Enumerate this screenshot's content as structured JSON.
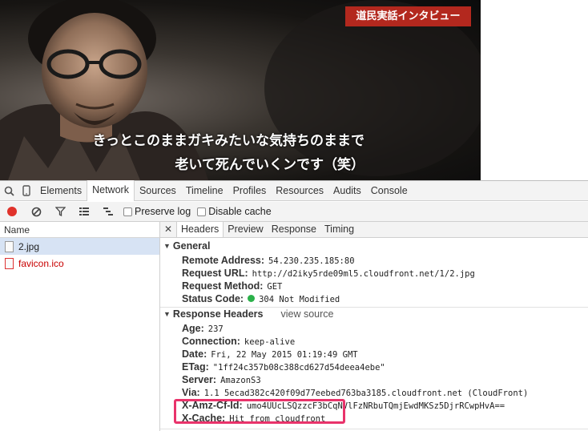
{
  "photo": {
    "badge": "道民実話インタビュー",
    "caption_line1": "きっとこのままガキみたいな気持ちのままで",
    "caption_line2": "老いて死んでいくンです（笑）"
  },
  "devtools": {
    "panel_tabs": [
      "Elements",
      "Network",
      "Sources",
      "Timeline",
      "Profiles",
      "Resources",
      "Audits",
      "Console"
    ],
    "active_panel": "Network",
    "toolbar": {
      "preserve_log": "Preserve log",
      "disable_cache": "Disable cache"
    },
    "requests": {
      "header": "Name",
      "items": [
        {
          "name": "2.jpg",
          "selected": true
        },
        {
          "name": "favicon.ico",
          "selected": false
        }
      ]
    },
    "detail_tabs": [
      "Headers",
      "Preview",
      "Response",
      "Timing"
    ],
    "general": {
      "title": "General",
      "fields": [
        {
          "k": "Remote Address:",
          "v": "54.230.235.185:80"
        },
        {
          "k": "Request URL:",
          "v": "http://d2iky5rde09ml5.cloudfront.net/1/2.jpg"
        },
        {
          "k": "Request Method:",
          "v": "GET"
        },
        {
          "k": "Status Code:",
          "v": "304 Not Modified"
        }
      ]
    },
    "response_headers": {
      "title": "Response Headers",
      "view_source": "view source",
      "fields": [
        {
          "k": "Age:",
          "v": "237"
        },
        {
          "k": "Connection:",
          "v": "keep-alive"
        },
        {
          "k": "Date:",
          "v": "Fri, 22 May 2015 01:19:49 GMT"
        },
        {
          "k": "ETag:",
          "v": "\"1ff24c357b08c388cd627d54deea4ebe\""
        },
        {
          "k": "Server:",
          "v": "AmazonS3"
        },
        {
          "k": "Via:",
          "v": "1.1 5ecad382c420f09d77eebed763ba3185.cloudfront.net (CloudFront)"
        },
        {
          "k": "X-Amz-Cf-Id:",
          "v": "umo4UUcLSQzzcF3bCqNVlFzNRbuTQmjEwdMKSz5DjrRCwpHvA=="
        },
        {
          "k": "X-Cache:",
          "v": "Hit from cloudfront"
        }
      ]
    },
    "colors": {
      "highlight": "#e9336b",
      "record": "#e0322b",
      "status_ok": "#2bb14a",
      "badge": "#b3281e"
    }
  }
}
